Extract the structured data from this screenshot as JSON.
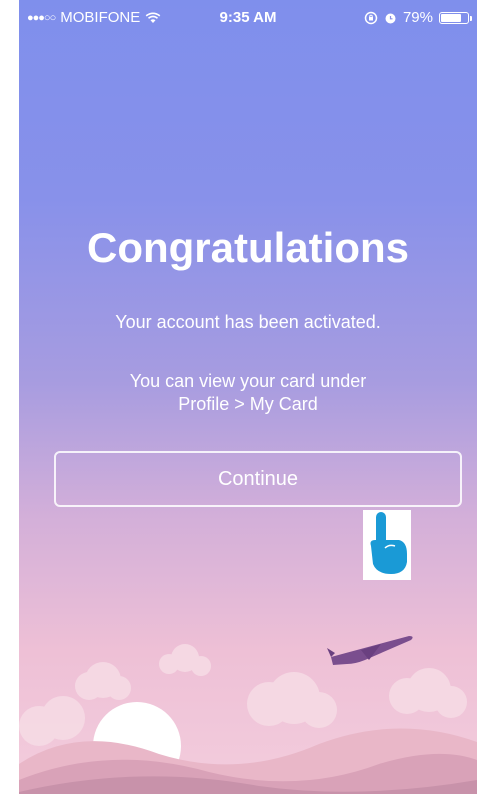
{
  "status_bar": {
    "signal_dots": "●●●○○",
    "carrier": "MOBIFONE",
    "wifi_icon": "wifi-icon",
    "time": "9:35 AM",
    "battery_percent": "79%",
    "battery_level": 0.79
  },
  "main": {
    "title": "Congratulations",
    "subtitle": "Your account has been activated.",
    "info_line1": "You can view your card under",
    "info_line2": "Profile > My Card",
    "continue_label": "Continue"
  },
  "colors": {
    "gradient_top": "#7f8fec",
    "gradient_bottom": "#f3cddd",
    "hand_icon": "#1a9ad6",
    "plane": "#7a4e8e"
  }
}
